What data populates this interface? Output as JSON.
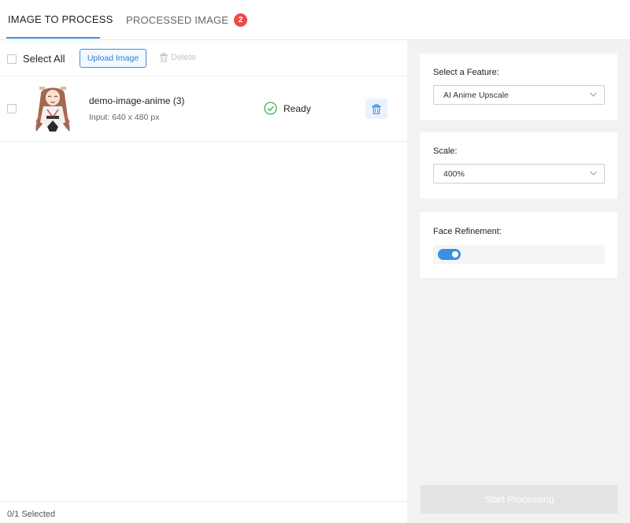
{
  "tabs": {
    "active_label": "IMAGE TO PROCESS",
    "processed_label": "PROCESSED IMAGE",
    "processed_count": "2"
  },
  "toolbar": {
    "select_all_label": "Select All",
    "upload_label": "Upload Image",
    "delete_label": "Delete"
  },
  "files": [
    {
      "name": "demo-image-anime (3)",
      "size": "Input: 640 x 480 px",
      "status": "Ready",
      "status_icon": "check-circle-icon"
    }
  ],
  "footer": {
    "selected": "0/1 Selected"
  },
  "settings": {
    "feature_label": "Select a Feature:",
    "feature_value": "AI Anime Upscale",
    "scale_label": "Scale:",
    "scale_value": "400%",
    "face_label": "Face Refinement:",
    "face_enabled": true
  },
  "actions": {
    "start_label": "Start Processing"
  },
  "colors": {
    "accent": "#3b8fe0",
    "badge": "#ef4a4a",
    "ready": "#3cb34a"
  }
}
